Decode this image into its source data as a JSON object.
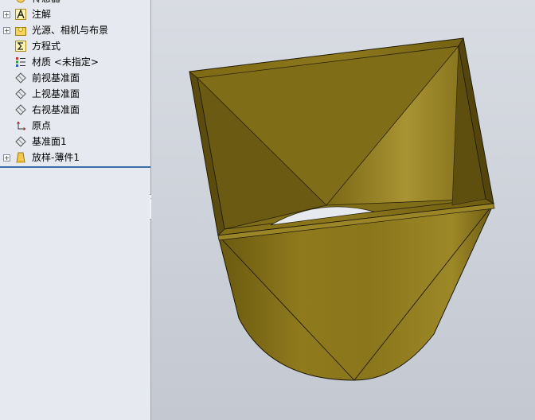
{
  "feature_tree": {
    "items": [
      {
        "label": "传感器",
        "icon": "sensor-icon",
        "expandable": false
      },
      {
        "label": "注解",
        "icon": "annotation-icon",
        "expandable": true
      },
      {
        "label": "光源、相机与布景",
        "icon": "lights-icon",
        "expandable": true
      },
      {
        "label": "方程式",
        "icon": "equation-icon",
        "expandable": false
      },
      {
        "label": "材质 <未指定>",
        "icon": "material-icon",
        "expandable": false
      },
      {
        "label": "前视基准面",
        "icon": "plane-icon",
        "expandable": false
      },
      {
        "label": "上视基准面",
        "icon": "plane-icon",
        "expandable": false
      },
      {
        "label": "右视基准面",
        "icon": "plane-icon",
        "expandable": false
      },
      {
        "label": "原点",
        "icon": "origin-icon",
        "expandable": false
      },
      {
        "label": "基准面1",
        "icon": "plane-icon",
        "expandable": false
      },
      {
        "label": "放样-薄件1",
        "icon": "loft-thin-icon",
        "expandable": true
      }
    ],
    "expand_glyph": "+",
    "splitter_glyph": "‹‹"
  },
  "colors": {
    "model_fill": "#8a7519",
    "model_dark": "#5e500f",
    "model_light": "#a8922e",
    "edge": "#1f1a06"
  }
}
